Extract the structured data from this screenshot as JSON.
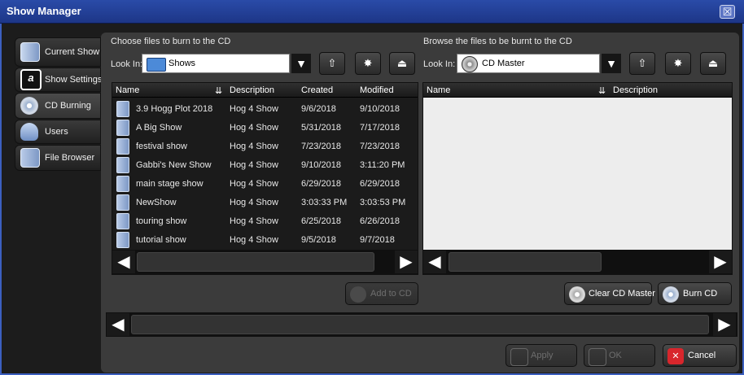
{
  "window": {
    "title": "Show Manager",
    "close_glyph": "☒"
  },
  "sidebar": {
    "items": [
      {
        "label": "Current Show",
        "icon": "show-file-icon"
      },
      {
        "label": "Show Settings",
        "icon": "settings-icon"
      },
      {
        "label": "CD Burning",
        "icon": "cd-burn-icon"
      },
      {
        "label": "Users",
        "icon": "user-icon"
      },
      {
        "label": "File Browser",
        "icon": "file-browser-icon"
      }
    ]
  },
  "left_panel": {
    "heading": "Choose files to burn to the CD",
    "look_in_label": "Look In:",
    "look_in_value": "Shows",
    "columns": [
      "Name",
      "Description",
      "Created",
      "Modified"
    ],
    "rows": [
      {
        "name": "3.9 Hogg Plot 2018",
        "description": "Hog 4 Show",
        "created": "9/6/2018",
        "modified": "9/10/2018"
      },
      {
        "name": "A Big Show",
        "description": "Hog 4 Show",
        "created": "5/31/2018",
        "modified": "7/17/2018"
      },
      {
        "name": "festival show",
        "description": "Hog 4 Show",
        "created": "7/23/2018",
        "modified": "7/23/2018"
      },
      {
        "name": "Gabbi's New Show",
        "description": "Hog 4 Show",
        "created": "9/10/2018",
        "modified": "3:11:20 PM"
      },
      {
        "name": "main stage show",
        "description": "Hog 4 Show",
        "created": "6/29/2018",
        "modified": "6/29/2018"
      },
      {
        "name": "NewShow",
        "description": "Hog 4 Show",
        "created": "3:03:33 PM",
        "modified": "3:03:53 PM"
      },
      {
        "name": "touring show",
        "description": "Hog 4 Show",
        "created": "6/25/2018",
        "modified": "6/26/2018"
      },
      {
        "name": "tutorial show",
        "description": "Hog 4 Show",
        "created": "9/5/2018",
        "modified": "9/7/2018"
      }
    ],
    "add_button": "Add to CD"
  },
  "right_panel": {
    "heading": "Browse the files to be burnt to the CD",
    "look_in_label": "Look In:",
    "look_in_value": "CD Master",
    "columns": [
      "Name",
      "Description"
    ],
    "clear_button": "Clear CD Master",
    "burn_button": "Burn CD"
  },
  "footer": {
    "apply": "Apply",
    "ok": "OK",
    "cancel": "Cancel"
  },
  "colors": {
    "titlebar": "#2a4ba8",
    "cancel_icon": "#d8262c",
    "folder": "#4c8ad8"
  }
}
